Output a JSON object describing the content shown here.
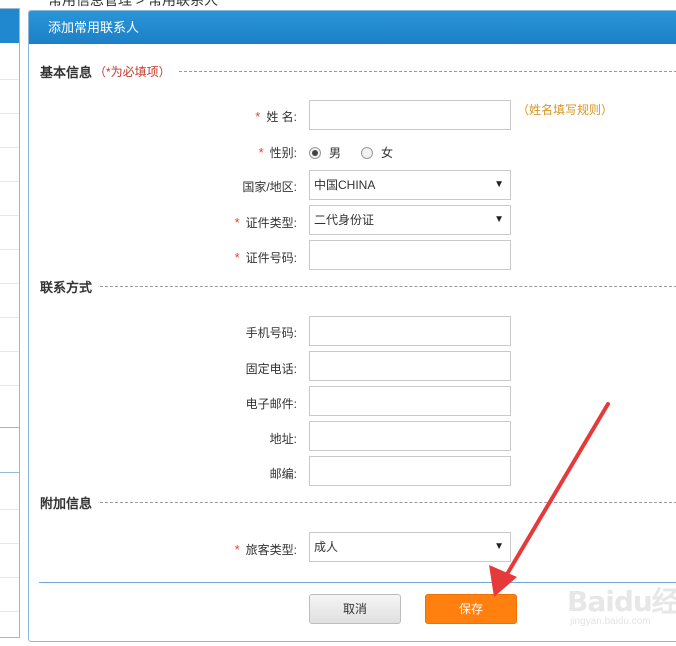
{
  "breadcrumb": "常用信息管理 > 常用联系人",
  "panel": {
    "title": "添加常用联系人"
  },
  "sections": {
    "basic": {
      "title": "基本信息",
      "note": "（*为必填项）"
    },
    "contact": {
      "title": "联系方式"
    },
    "extra": {
      "title": "附加信息"
    }
  },
  "fields": {
    "name": {
      "label": "姓 名:",
      "required": "*",
      "value": "",
      "hint": "（姓名填写规则）"
    },
    "gender": {
      "label": "性别:",
      "required": "*",
      "options": [
        "男",
        "女"
      ],
      "selected": "男"
    },
    "country": {
      "label": "国家/地区:",
      "value": "中国CHINA"
    },
    "id_type": {
      "label": "证件类型:",
      "required": "*",
      "value": "二代身份证"
    },
    "id_number": {
      "label": "证件号码:",
      "required": "*",
      "value": ""
    },
    "mobile": {
      "label": "手机号码:",
      "value": ""
    },
    "phone": {
      "label": "固定电话:",
      "value": ""
    },
    "email": {
      "label": "电子邮件:",
      "value": ""
    },
    "address": {
      "label": "地址:",
      "value": ""
    },
    "postcode": {
      "label": "邮编:",
      "value": ""
    },
    "passenger_type": {
      "label": "旅客类型:",
      "required": "*",
      "value": "成人"
    }
  },
  "buttons": {
    "cancel": "取消",
    "save": "保存"
  },
  "icons": {
    "dropdown": "chevron-down-icon",
    "annotation": "red-arrow-icon"
  },
  "colors": {
    "header": "#1f88cf",
    "required": "#e8412c",
    "hint": "#d9941e",
    "save": "#ff7f0f",
    "arrow": "#e63a3a"
  },
  "watermark": {
    "brand": "Baidu经验",
    "url": "jingyan.baidu.com"
  }
}
